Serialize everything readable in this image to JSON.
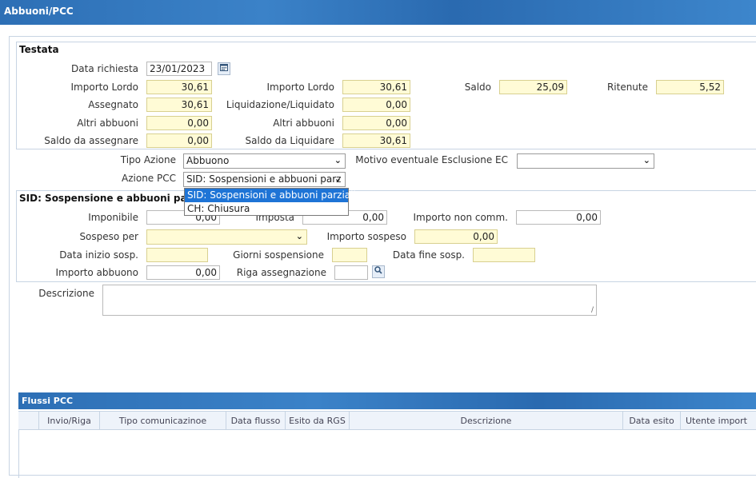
{
  "window": {
    "title": "Abbuoni/PCC"
  },
  "testata": {
    "legend": "Testata",
    "data_richiesta": {
      "label": "Data richiesta",
      "value": "23/01/2023",
      "icon": "calendar-icon"
    },
    "importo_lordo_1": {
      "label": "Importo Lordo",
      "value": "30,61"
    },
    "importo_lordo_2": {
      "label": "Importo Lordo",
      "value": "30,61"
    },
    "saldo": {
      "label": "Saldo",
      "value": "25,09"
    },
    "ritenute": {
      "label": "Ritenute",
      "value": "5,52"
    },
    "assegnato": {
      "label": "Assegnato",
      "value": "30,61"
    },
    "liquidazione": {
      "label": "Liquidazione/Liquidato",
      "value": "0,00"
    },
    "altri_abbuoni_1": {
      "label": "Altri abbuoni",
      "value": "0,00"
    },
    "altri_abbuoni_2": {
      "label": "Altri abbuoni",
      "value": "0,00"
    },
    "saldo_assegnare": {
      "label": "Saldo da assegnare",
      "value": "0,00"
    },
    "saldo_liquidare": {
      "label": "Saldo da Liquidare",
      "value": "30,61"
    }
  },
  "azione": {
    "tipo_azione": {
      "label": "Tipo Azione",
      "value": "Abbuono"
    },
    "motivo": {
      "label": "Motivo eventuale Esclusione EC",
      "value": ""
    },
    "azione_pcc": {
      "label": "Azione PCC",
      "value": "SID: Sospensioni e abbuoni parz",
      "options": [
        "SID: Sospensioni e abbuoni parziali",
        "CH: Chiusura"
      ]
    }
  },
  "sid": {
    "legend": "SID: Sospensione e abbuoni parziali",
    "imponibile": {
      "label": "Imponibile",
      "value": "0,00"
    },
    "imposta": {
      "label": "Imposta",
      "value": "0,00"
    },
    "importo_non_comm": {
      "label": "Importo non comm.",
      "value": "0,00"
    },
    "sospeso_per": {
      "label": "Sospeso per",
      "value": ""
    },
    "importo_sospeso": {
      "label": "Importo sospeso",
      "value": "0,00"
    },
    "data_inizio": {
      "label": "Data inizio sosp.",
      "value": ""
    },
    "giorni": {
      "label": "Giorni sospensione",
      "value": ""
    },
    "data_fine": {
      "label": "Data fine sosp.",
      "value": ""
    },
    "importo_abbuono": {
      "label": "Importo abbuono",
      "value": "0,00"
    },
    "riga_assegnazione": {
      "label": "Riga assegnazione",
      "value": "",
      "icon": "search-icon"
    }
  },
  "descrizione": {
    "label": "Descrizione",
    "value": ""
  },
  "flussi": {
    "title": "Flussi PCC",
    "columns": [
      "Invio/Riga",
      "Tipo comunicazinoe",
      "Data flusso",
      "Esito da RGS",
      "Descrizione",
      "Data esito",
      "Utente import"
    ],
    "rows": []
  },
  "colors": {
    "header": "#2d6fb5",
    "input_yellow": "#fffbd6",
    "dropdown_highlight": "#1e74d6"
  }
}
